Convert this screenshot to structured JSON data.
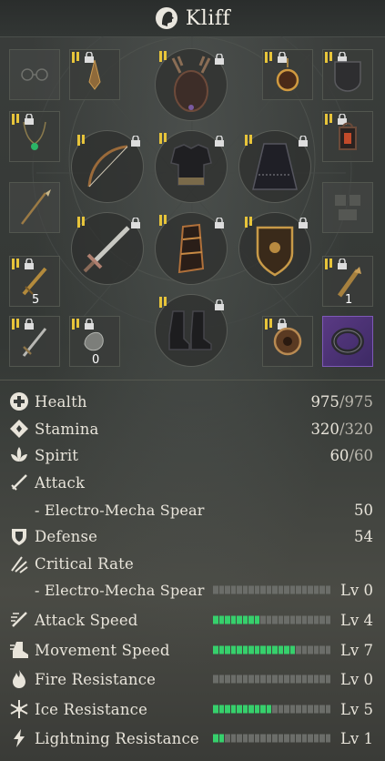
{
  "header": {
    "title": "Kliff",
    "icon": "character-portrait-icon"
  },
  "equipment": {
    "counts": {
      "dagger": "5",
      "armlet": "0",
      "torch": "1"
    }
  },
  "stats": {
    "health": {
      "label": "Health",
      "value": "975",
      "max": "/975"
    },
    "stamina": {
      "label": "Stamina",
      "value": "320",
      "max": "/320"
    },
    "spirit": {
      "label": "Spirit",
      "value": "60",
      "max": "/60"
    },
    "attack": {
      "label": "Attack"
    },
    "attack_weapon": {
      "label": "- Electro-Mecha Spear",
      "value": "50"
    },
    "defense": {
      "label": "Defense",
      "value": "54"
    },
    "crit": {
      "label": "Critical Rate"
    },
    "crit_weapon": {
      "label": "- Electro-Mecha Spear",
      "value": "Lv 0",
      "level": 0
    },
    "attack_speed": {
      "label": "Attack Speed",
      "value": "Lv 4",
      "level": 4
    },
    "move_speed": {
      "label": "Movement Speed",
      "value": "Lv 7",
      "level": 7
    },
    "fire_res": {
      "label": "Fire Resistance",
      "value": "Lv 0",
      "level": 0
    },
    "ice_res": {
      "label": "Ice Resistance",
      "value": "Lv 5",
      "level": 5
    },
    "lightning_res": {
      "label": "Lightning Resistance",
      "value": "Lv 1",
      "level": 1
    }
  },
  "colors": {
    "accent_gold": "#e7c43a",
    "meter_on": "#36d06c",
    "meter_off": "#6b6d69",
    "rare_purple": "#5a3a84"
  }
}
